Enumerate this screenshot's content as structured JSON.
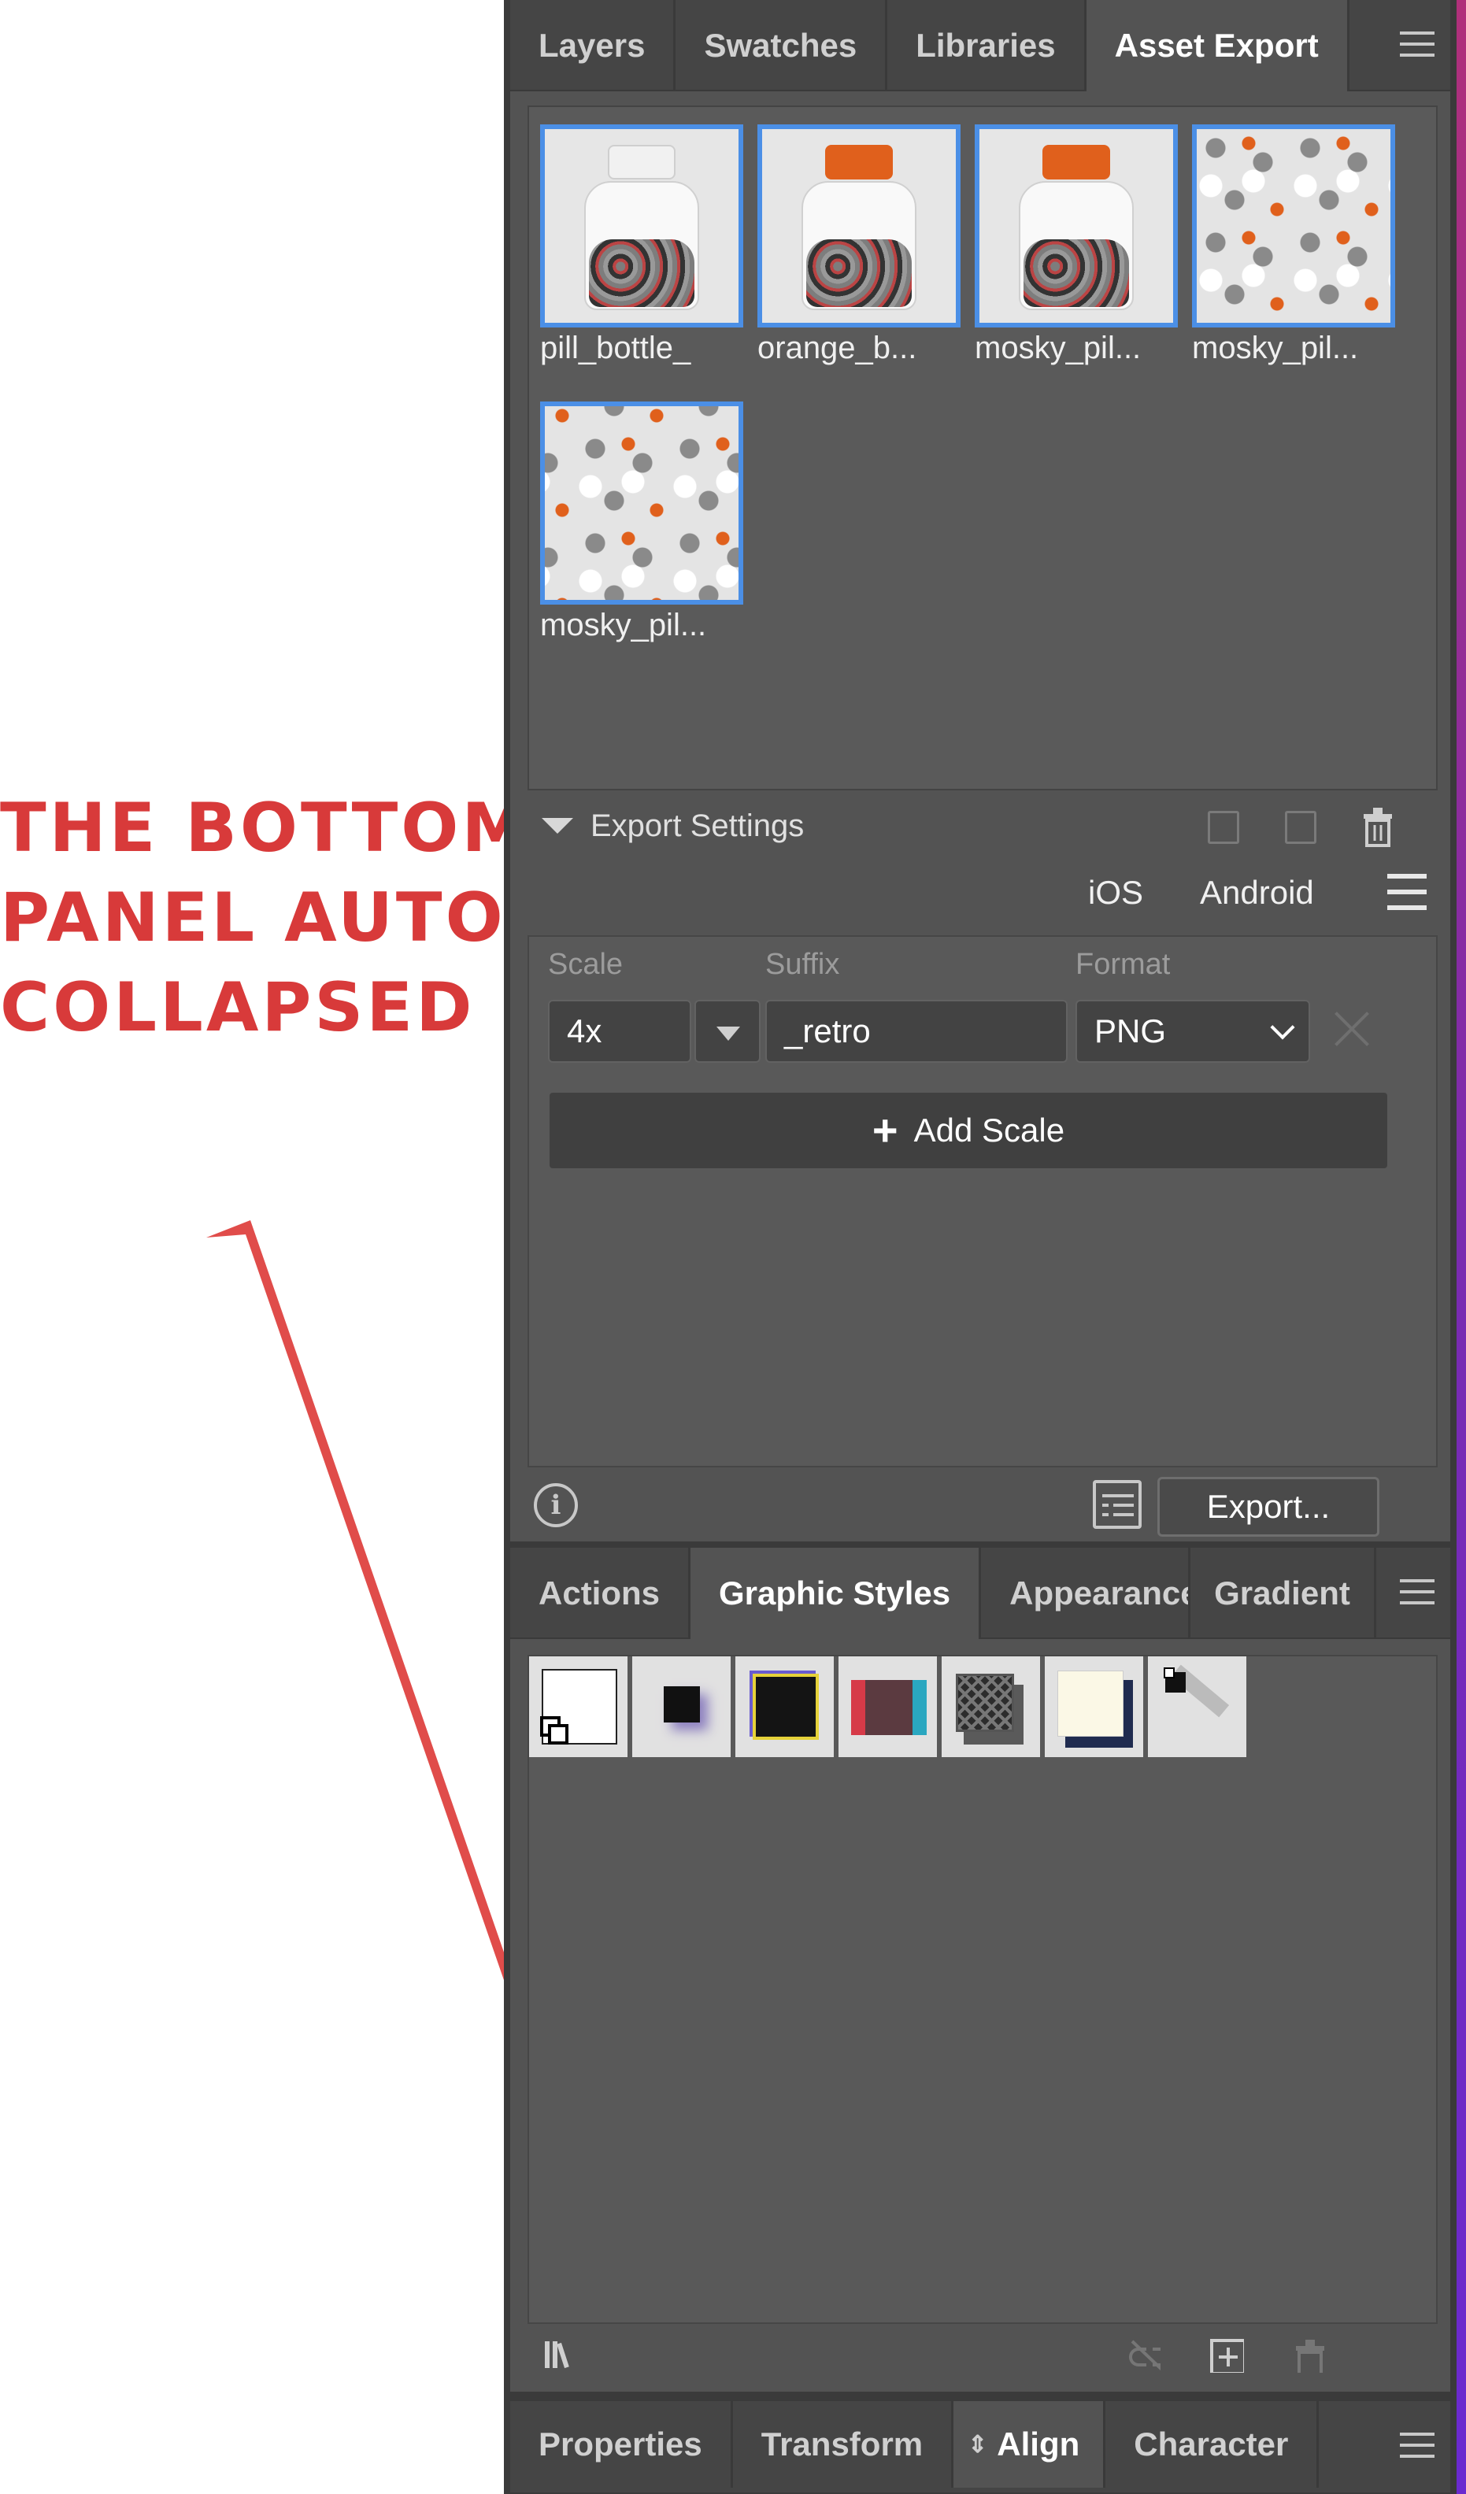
{
  "annotation": {
    "lines": [
      "THE BOTTOM",
      "PANEL AUTO-",
      "COLLAPSED"
    ],
    "color": "#d83a3a"
  },
  "top_panel": {
    "tabs": [
      {
        "label": "Layers",
        "active": false
      },
      {
        "label": "Swatches",
        "active": false
      },
      {
        "label": "Libraries",
        "active": false
      },
      {
        "label": "Asset Export",
        "active": true
      }
    ],
    "assets": [
      {
        "name": "pill_bottle_",
        "kind": "bottle-clear"
      },
      {
        "name": "orange_b...",
        "kind": "bottle-orange"
      },
      {
        "name": "mosky_pil...",
        "kind": "bottle-orange"
      },
      {
        "name": "mosky_pil...",
        "kind": "pattern"
      },
      {
        "name": "mosky_pil...",
        "kind": "pattern"
      }
    ],
    "export_settings": {
      "title": "Export Settings",
      "platforms": [
        "iOS",
        "Android"
      ],
      "columns": {
        "scale": "Scale",
        "suffix": "Suffix",
        "format": "Format"
      },
      "row": {
        "scale": "4x",
        "suffix": "_retro",
        "format": "PNG"
      },
      "add_scale_label": "Add Scale",
      "export_button": "Export..."
    }
  },
  "middle_panel": {
    "tabs": [
      {
        "label": "Actions",
        "active": false
      },
      {
        "label": "Graphic Styles",
        "active": true
      },
      {
        "label": "Appearance",
        "active": false
      },
      {
        "label": "Gradient",
        "active": false
      }
    ],
    "styles": [
      "default",
      "soft-shadow",
      "black-neon",
      "bicolor",
      "mesh-shadow",
      "cream-3d",
      "black-shadow"
    ]
  },
  "bottom_panel": {
    "tabs": [
      {
        "label": "Properties",
        "active": false
      },
      {
        "label": "Transform",
        "active": false
      },
      {
        "label": "Align",
        "active": true
      },
      {
        "label": "Character",
        "active": false
      }
    ]
  },
  "colors": {
    "panel_bg": "#535353",
    "tab_bar_bg": "#454545",
    "selection_blue": "#4b8fe6",
    "accent_orange": "#e0601c"
  }
}
